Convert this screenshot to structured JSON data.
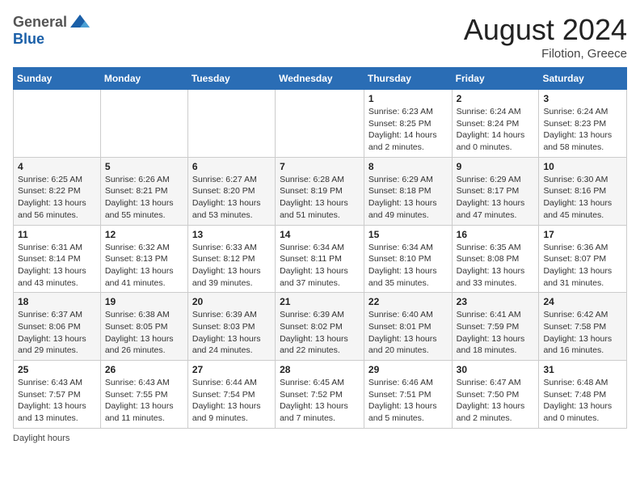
{
  "header": {
    "logo_general": "General",
    "logo_blue": "Blue",
    "month_title": "August 2024",
    "location": "Filotion, Greece"
  },
  "footer": {
    "daylight_label": "Daylight hours"
  },
  "days_of_week": [
    "Sunday",
    "Monday",
    "Tuesday",
    "Wednesday",
    "Thursday",
    "Friday",
    "Saturday"
  ],
  "weeks": [
    [
      {
        "num": "",
        "info": ""
      },
      {
        "num": "",
        "info": ""
      },
      {
        "num": "",
        "info": ""
      },
      {
        "num": "",
        "info": ""
      },
      {
        "num": "1",
        "info": "Sunrise: 6:23 AM\nSunset: 8:25 PM\nDaylight: 14 hours\nand 2 minutes."
      },
      {
        "num": "2",
        "info": "Sunrise: 6:24 AM\nSunset: 8:24 PM\nDaylight: 14 hours\nand 0 minutes."
      },
      {
        "num": "3",
        "info": "Sunrise: 6:24 AM\nSunset: 8:23 PM\nDaylight: 13 hours\nand 58 minutes."
      }
    ],
    [
      {
        "num": "4",
        "info": "Sunrise: 6:25 AM\nSunset: 8:22 PM\nDaylight: 13 hours\nand 56 minutes."
      },
      {
        "num": "5",
        "info": "Sunrise: 6:26 AM\nSunset: 8:21 PM\nDaylight: 13 hours\nand 55 minutes."
      },
      {
        "num": "6",
        "info": "Sunrise: 6:27 AM\nSunset: 8:20 PM\nDaylight: 13 hours\nand 53 minutes."
      },
      {
        "num": "7",
        "info": "Sunrise: 6:28 AM\nSunset: 8:19 PM\nDaylight: 13 hours\nand 51 minutes."
      },
      {
        "num": "8",
        "info": "Sunrise: 6:29 AM\nSunset: 8:18 PM\nDaylight: 13 hours\nand 49 minutes."
      },
      {
        "num": "9",
        "info": "Sunrise: 6:29 AM\nSunset: 8:17 PM\nDaylight: 13 hours\nand 47 minutes."
      },
      {
        "num": "10",
        "info": "Sunrise: 6:30 AM\nSunset: 8:16 PM\nDaylight: 13 hours\nand 45 minutes."
      }
    ],
    [
      {
        "num": "11",
        "info": "Sunrise: 6:31 AM\nSunset: 8:14 PM\nDaylight: 13 hours\nand 43 minutes."
      },
      {
        "num": "12",
        "info": "Sunrise: 6:32 AM\nSunset: 8:13 PM\nDaylight: 13 hours\nand 41 minutes."
      },
      {
        "num": "13",
        "info": "Sunrise: 6:33 AM\nSunset: 8:12 PM\nDaylight: 13 hours\nand 39 minutes."
      },
      {
        "num": "14",
        "info": "Sunrise: 6:34 AM\nSunset: 8:11 PM\nDaylight: 13 hours\nand 37 minutes."
      },
      {
        "num": "15",
        "info": "Sunrise: 6:34 AM\nSunset: 8:10 PM\nDaylight: 13 hours\nand 35 minutes."
      },
      {
        "num": "16",
        "info": "Sunrise: 6:35 AM\nSunset: 8:08 PM\nDaylight: 13 hours\nand 33 minutes."
      },
      {
        "num": "17",
        "info": "Sunrise: 6:36 AM\nSunset: 8:07 PM\nDaylight: 13 hours\nand 31 minutes."
      }
    ],
    [
      {
        "num": "18",
        "info": "Sunrise: 6:37 AM\nSunset: 8:06 PM\nDaylight: 13 hours\nand 29 minutes."
      },
      {
        "num": "19",
        "info": "Sunrise: 6:38 AM\nSunset: 8:05 PM\nDaylight: 13 hours\nand 26 minutes."
      },
      {
        "num": "20",
        "info": "Sunrise: 6:39 AM\nSunset: 8:03 PM\nDaylight: 13 hours\nand 24 minutes."
      },
      {
        "num": "21",
        "info": "Sunrise: 6:39 AM\nSunset: 8:02 PM\nDaylight: 13 hours\nand 22 minutes."
      },
      {
        "num": "22",
        "info": "Sunrise: 6:40 AM\nSunset: 8:01 PM\nDaylight: 13 hours\nand 20 minutes."
      },
      {
        "num": "23",
        "info": "Sunrise: 6:41 AM\nSunset: 7:59 PM\nDaylight: 13 hours\nand 18 minutes."
      },
      {
        "num": "24",
        "info": "Sunrise: 6:42 AM\nSunset: 7:58 PM\nDaylight: 13 hours\nand 16 minutes."
      }
    ],
    [
      {
        "num": "25",
        "info": "Sunrise: 6:43 AM\nSunset: 7:57 PM\nDaylight: 13 hours\nand 13 minutes."
      },
      {
        "num": "26",
        "info": "Sunrise: 6:43 AM\nSunset: 7:55 PM\nDaylight: 13 hours\nand 11 minutes."
      },
      {
        "num": "27",
        "info": "Sunrise: 6:44 AM\nSunset: 7:54 PM\nDaylight: 13 hours\nand 9 minutes."
      },
      {
        "num": "28",
        "info": "Sunrise: 6:45 AM\nSunset: 7:52 PM\nDaylight: 13 hours\nand 7 minutes."
      },
      {
        "num": "29",
        "info": "Sunrise: 6:46 AM\nSunset: 7:51 PM\nDaylight: 13 hours\nand 5 minutes."
      },
      {
        "num": "30",
        "info": "Sunrise: 6:47 AM\nSunset: 7:50 PM\nDaylight: 13 hours\nand 2 minutes."
      },
      {
        "num": "31",
        "info": "Sunrise: 6:48 AM\nSunset: 7:48 PM\nDaylight: 13 hours\nand 0 minutes."
      }
    ]
  ]
}
